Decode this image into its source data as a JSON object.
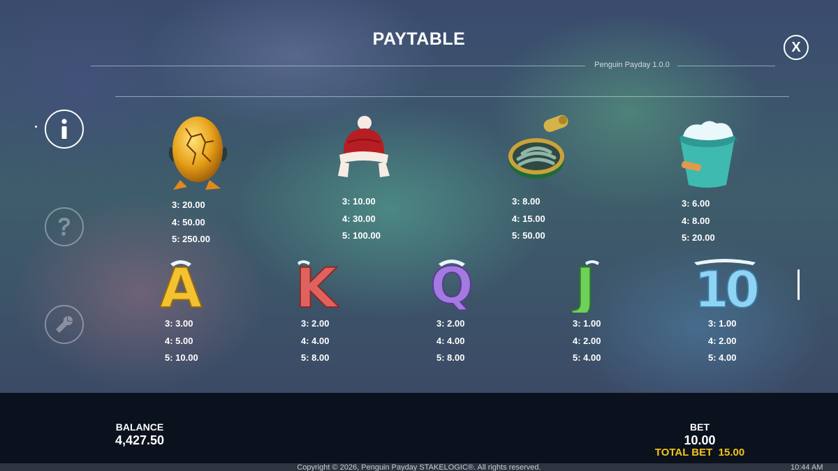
{
  "header": {
    "title": "PAYTABLE",
    "version": "Penguin Payday 1.0.0",
    "close_label": "X"
  },
  "sidebar": {
    "items": [
      {
        "icon": "info-icon",
        "active": true
      },
      {
        "icon": "help-icon",
        "active": false
      },
      {
        "icon": "settings-wrench-icon",
        "active": false
      }
    ]
  },
  "paytable": {
    "row1": [
      {
        "symbol": "golden-egg",
        "pays": [
          "3: 20.00",
          "4: 50.00",
          "5: 250.00"
        ]
      },
      {
        "symbol": "winter-hat",
        "pays": [
          "3: 10.00",
          "4: 30.00",
          "5: 100.00"
        ]
      },
      {
        "symbol": "sardine-can",
        "pays": [
          "3: 8.00",
          "4: 15.00",
          "5: 50.00"
        ]
      },
      {
        "symbol": "ice-bucket",
        "pays": [
          "3: 6.00",
          "4: 8.00",
          "5: 20.00"
        ]
      }
    ],
    "row2": [
      {
        "symbol": "A",
        "pays": [
          "3: 3.00",
          "4: 5.00",
          "5: 10.00"
        ]
      },
      {
        "symbol": "K",
        "pays": [
          "3: 2.00",
          "4: 4.00",
          "5: 8.00"
        ]
      },
      {
        "symbol": "Q",
        "pays": [
          "3: 2.00",
          "4: 4.00",
          "5: 8.00"
        ]
      },
      {
        "symbol": "J",
        "pays": [
          "3: 1.00",
          "4: 2.00",
          "5: 4.00"
        ]
      },
      {
        "symbol": "10",
        "pays": [
          "3: 1.00",
          "4: 2.00",
          "5: 4.00"
        ]
      }
    ]
  },
  "colors": {
    "A": "#f2c230",
    "K": "#e0625e",
    "Q": "#a37ae0",
    "J": "#6fd05a",
    "10": "#8fd4f2",
    "total_bet": "#f5c518"
  },
  "footer": {
    "balance_label": "BALANCE",
    "balance_value": "4,427.50",
    "bet_label": "BET",
    "bet_value": "10.00",
    "total_bet_label": "TOTAL BET",
    "total_bet_value": "15.00",
    "copyright": "Copyright © 2026, Penguin Payday STAKELOGIC®. All rights reserved.",
    "clock": "10:44 AM"
  }
}
